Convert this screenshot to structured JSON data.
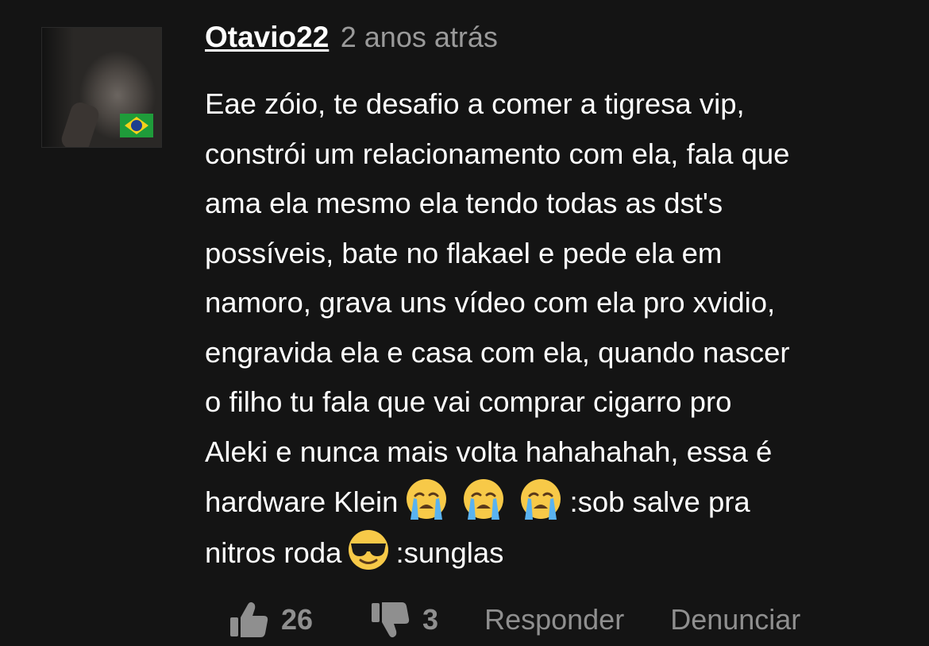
{
  "comment": {
    "username": "Otavio22",
    "timestamp": "2 anos atrás",
    "avatar": {
      "flag": "brazil-flag"
    },
    "lines": [
      "Eae zóio, te desafio a comer a tigresa vip,",
      "constrói um relacionamento com ela, fala que",
      "ama ela mesmo ela tendo todas as dst's",
      "possíveis, bate no flakael e pede ela em",
      "namoro, grava uns vídeo com ela pro xvidio,",
      "engravida ela e casa com ela, quando nascer",
      "o filho tu fala que vai comprar cigarro pro",
      "Aleki e nunca mais volta hahahahah, essa é"
    ],
    "line9_text": "hardware Klein",
    "line9_suffix": ":sob salve pra",
    "line10_text": "nitros roda",
    "line10_suffix": ":sunglas",
    "emojis": [
      "sob-emoji",
      "sob-emoji",
      "sob-emoji",
      "sunglasses-emoji"
    ]
  },
  "actions": {
    "like_count": "26",
    "dislike_count": "3",
    "reply_label": "Responder",
    "report_label": "Denunciar",
    "icon_like": "thumbs-up-icon",
    "icon_dislike": "thumbs-down-icon"
  },
  "colors": {
    "background": "#141414",
    "text": "#ffffff",
    "muted": "#9a9a9a",
    "action": "#8f8f8f",
    "flag_green": "#1f9c3a",
    "flag_yellow": "#f5d21a",
    "flag_blue": "#1d3f8f"
  }
}
